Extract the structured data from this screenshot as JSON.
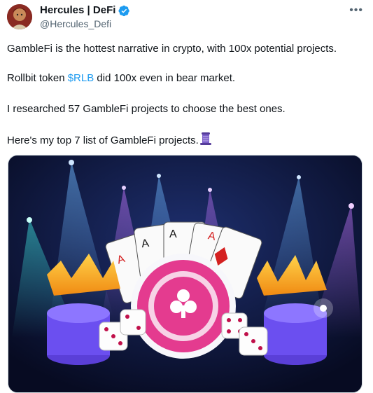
{
  "author": {
    "name": "Hercules | DeFi",
    "handle": "@Hercules_Defi"
  },
  "tweet": {
    "line1": "GambleFi is the hottest narrative in crypto, with 100x potential projects.",
    "line2_prefix": "Rollbit token ",
    "cashtag": "$RLB",
    "line2_suffix": " did 100x even in bear market.",
    "line3": "I researched 57 GambleFi projects to choose the best ones.",
    "line4": "Here's my top 7 list of GambleFi projects."
  },
  "icons": {
    "verified": "verified-badge-icon",
    "more": "more-options-icon",
    "scroll_emoji": "scroll-emoji-icon"
  },
  "colors": {
    "link": "#1d9bf0",
    "verified": "#1d9bf0",
    "secondary_text": "#536471"
  }
}
